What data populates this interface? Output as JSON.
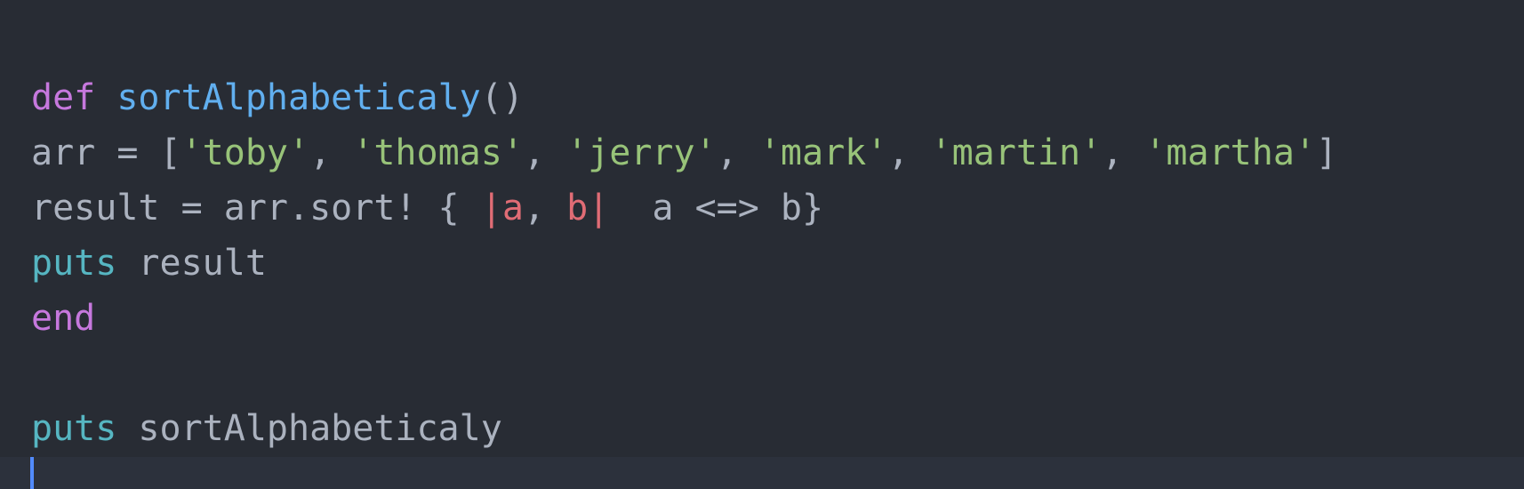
{
  "colors": {
    "background": "#282c34",
    "current_line": "#2c313c",
    "keyword": "#c678dd",
    "function": "#61afef",
    "string": "#98c379",
    "builtin": "#56b6c2",
    "param": "#e06c75",
    "plain": "#abb2bf",
    "cursor": "#528bff"
  },
  "lines": [
    [
      {
        "text": "def",
        "role": "keyword"
      },
      {
        "text": " ",
        "role": "plain"
      },
      {
        "text": "sortAlphabeticaly",
        "role": "function"
      },
      {
        "text": "()",
        "role": "plain"
      }
    ],
    [
      {
        "text": "arr = [",
        "role": "plain"
      },
      {
        "text": "'toby'",
        "role": "string"
      },
      {
        "text": ", ",
        "role": "plain"
      },
      {
        "text": "'thomas'",
        "role": "string"
      },
      {
        "text": ", ",
        "role": "plain"
      },
      {
        "text": "'jerry'",
        "role": "string"
      },
      {
        "text": ", ",
        "role": "plain"
      },
      {
        "text": "'mark'",
        "role": "string"
      },
      {
        "text": ", ",
        "role": "plain"
      },
      {
        "text": "'martin'",
        "role": "string"
      },
      {
        "text": ", ",
        "role": "plain"
      },
      {
        "text": "'martha'",
        "role": "string"
      },
      {
        "text": "]",
        "role": "plain"
      }
    ],
    [
      {
        "text": "result = arr.sort! { ",
        "role": "plain"
      },
      {
        "text": "|a",
        "role": "param"
      },
      {
        "text": ", ",
        "role": "plain"
      },
      {
        "text": "b|",
        "role": "param"
      },
      {
        "text": "  a <=> b}",
        "role": "plain"
      }
    ],
    [
      {
        "text": "puts",
        "role": "builtin"
      },
      {
        "text": " result",
        "role": "plain"
      }
    ],
    [
      {
        "text": "end",
        "role": "keyword"
      }
    ],
    [],
    [
      {
        "text": "puts",
        "role": "builtin"
      },
      {
        "text": " sortAlphabeticaly",
        "role": "plain"
      }
    ]
  ]
}
